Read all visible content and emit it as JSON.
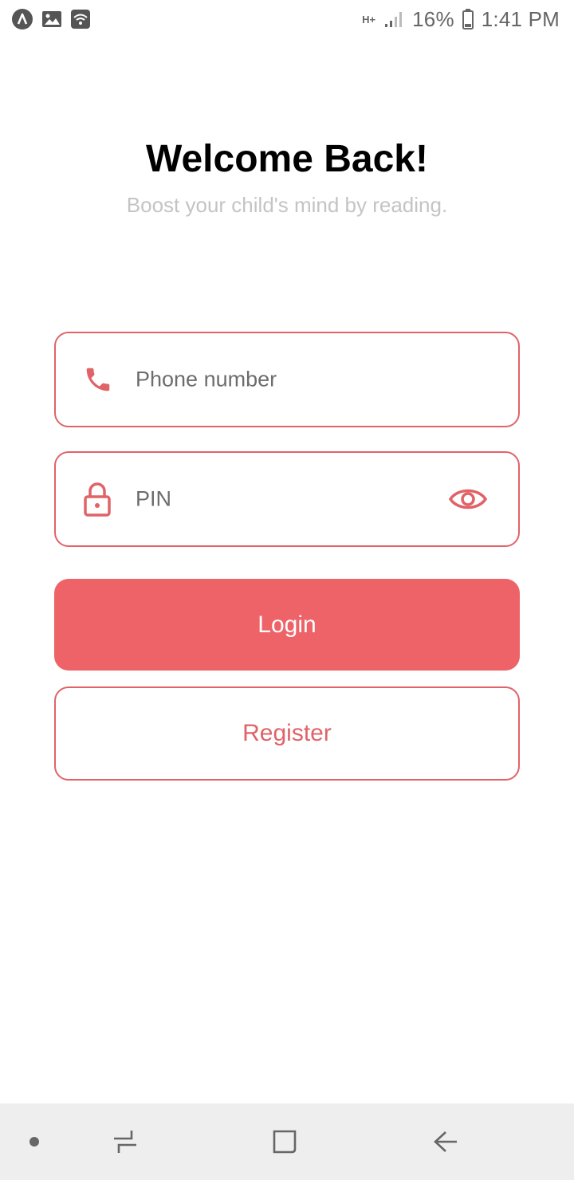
{
  "status_bar": {
    "left_icons": [
      "app-notification-icon",
      "image-icon",
      "wifi-icon"
    ],
    "network_label": "H+",
    "battery": "16%",
    "time": "1:41 PM"
  },
  "header": {
    "title": "Welcome Back!",
    "subtitle": "Boost your child's mind by reading."
  },
  "form": {
    "phone": {
      "icon": "phone-icon",
      "placeholder": "Phone number",
      "value": ""
    },
    "pin": {
      "icon": "lock-icon",
      "placeholder": "PIN",
      "value": "",
      "toggle_icon": "eye-icon"
    }
  },
  "actions": {
    "login_label": "Login",
    "register_label": "Register"
  },
  "nav_bar": {
    "items": [
      "dot-icon",
      "recent-apps-icon",
      "home-icon",
      "back-icon"
    ]
  },
  "colors": {
    "accent": "#ee6367",
    "accent_border": "#e06368",
    "title": "#000000",
    "subtitle": "#c4c4c4",
    "placeholder": "#6d6d6d",
    "nav_background": "#eeeeee"
  }
}
